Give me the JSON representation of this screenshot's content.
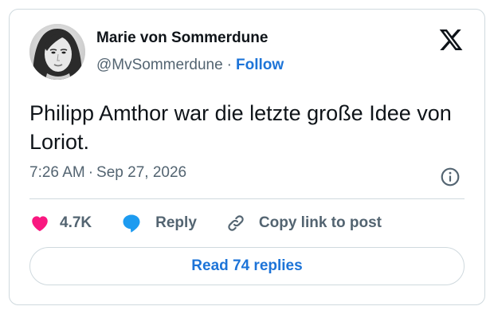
{
  "user": {
    "display_name": "Marie von Sommerdune",
    "handle": "@MvSommerdune",
    "separator": "·",
    "follow_label": "Follow"
  },
  "tweet": {
    "text": "Philipp Amthor war die letzte große Idee von Loriot.",
    "time": "7:26 AM",
    "date_separator": "·",
    "date": "Sep 27, 2026"
  },
  "actions": {
    "like_count": "4.7K",
    "reply_label": "Reply",
    "copy_label": "Copy link to post"
  },
  "read_replies_label": "Read 74 replies",
  "colors": {
    "link": "#1d74d8",
    "like_heart": "#f91880",
    "reply_bubble": "#1d9bf0",
    "border": "#cfd9de",
    "secondary_text": "#536471",
    "primary_text": "#0f1419"
  },
  "icons": [
    "x-logo-icon",
    "info-icon",
    "heart-icon",
    "reply-bubble-icon",
    "link-icon"
  ]
}
